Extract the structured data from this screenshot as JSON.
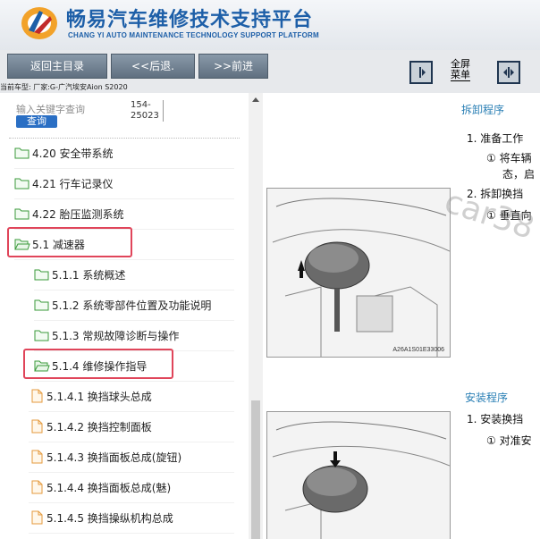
{
  "header": {
    "title": "畅易汽车维修技术支持平台",
    "subtitle": "CHANG YI AUTO MAINTENANCE TECHNOLOGY SUPPORT PLATFORM"
  },
  "toolbar": {
    "back_main": "返回主目录",
    "back": "<<后退.",
    "forward": ">>前进",
    "fullscreen_line1": "全屏",
    "fullscreen_line2": "菜单"
  },
  "vehicle_info": "当前车型:  厂家:G-广汽埃安Aion S2020",
  "search": {
    "placeholder": "输入关键字查询",
    "button": "查询",
    "code_line1": "154-",
    "code_line2": "25023"
  },
  "tree": {
    "items": [
      {
        "label": "4.20 安全带系统",
        "icon": "folder-icon"
      },
      {
        "label": "4.21 行车记录仪",
        "icon": "folder-icon"
      },
      {
        "label": "4.22 胎压监测系统",
        "icon": "folder-icon"
      },
      {
        "label": "5.1 减速器",
        "icon": "folder-open-icon"
      },
      {
        "label": "5.1.1 系统概述",
        "icon": "folder-icon"
      },
      {
        "label": "5.1.2 系统零部件位置及功能说明",
        "icon": "folder-icon"
      },
      {
        "label": "5.1.3 常规故障诊断与操作",
        "icon": "folder-icon"
      },
      {
        "label": "5.1.4 维修操作指导",
        "icon": "folder-open-icon"
      },
      {
        "label": "5.1.4.1 换挡球头总成",
        "icon": "document-icon"
      },
      {
        "label": "5.1.4.2 换挡控制面板",
        "icon": "document-icon"
      },
      {
        "label": "5.1.4.3 换挡面板总成(旋钮)",
        "icon": "document-icon"
      },
      {
        "label": "5.1.4.4 换挡面板总成(魅)",
        "icon": "document-icon"
      },
      {
        "label": "5.1.4.5 换挡操纵机构总成",
        "icon": "document-icon"
      }
    ]
  },
  "content": {
    "removal_title": "拆卸程序",
    "step1": "1.  准备工作",
    "step1_sub": "①  将车辆",
    "step1_sub2": "态，启",
    "step2": "2.  拆卸换挡",
    "step2_sub": "①  垂直向",
    "figure1_code": "A26A1S01E33006",
    "install_title": "安装程序",
    "install_step1": "1.  安装换挡",
    "install_step1_sub": "①  对准安",
    "watermark": "car38"
  },
  "colors": {
    "brand_blue": "#1d5fa8",
    "highlight_red": "#e0455a",
    "folder_green": "#3a9a3a",
    "document_orange": "#e49a3c",
    "section_blue": "#2a7fb5"
  }
}
